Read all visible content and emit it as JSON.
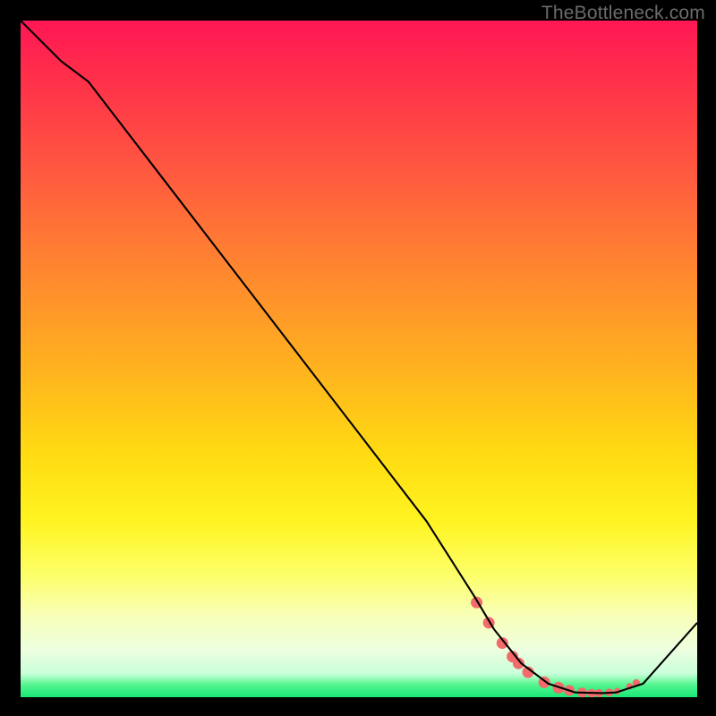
{
  "attribution": "TheBottleneck.com",
  "chart_data": {
    "type": "line",
    "title": "",
    "xlabel": "",
    "ylabel": "",
    "xlim": [
      0,
      100
    ],
    "ylim": [
      0,
      100
    ],
    "series": [
      {
        "name": "curve",
        "x": [
          0,
          6,
          10,
          20,
          30,
          40,
          50,
          60,
          67,
          70,
          74,
          78,
          82,
          86,
          88,
          92,
          100
        ],
        "y": [
          100,
          94,
          91,
          78,
          65,
          52,
          39,
          26,
          15,
          10,
          5,
          2,
          0.7,
          0.6,
          0.7,
          2,
          11
        ]
      }
    ],
    "markers": {
      "name": "cluster",
      "color": "#f26a6a",
      "x": [
        67.4,
        69.2,
        71.2,
        72.7,
        73.6,
        75.0,
        77.4,
        79.5,
        81.1,
        83.0,
        84.4,
        85.5,
        87.0,
        88.2,
        90.0,
        91.0
      ],
      "y": [
        14.0,
        11.0,
        8.0,
        6.0,
        5.0,
        3.7,
        2.2,
        1.4,
        1.0,
        0.7,
        0.6,
        0.6,
        0.7,
        0.9,
        1.6,
        2.1
      ],
      "r": [
        6.5,
        6.5,
        6.5,
        6.5,
        6.5,
        6.5,
        6.5,
        6.5,
        6.0,
        5.5,
        4.8,
        4.6,
        4.5,
        3.8,
        3.6,
        4.2
      ]
    },
    "gradient_stops": [
      {
        "pct": 0,
        "color": "#ff1756"
      },
      {
        "pct": 22,
        "color": "#ff5840"
      },
      {
        "pct": 52,
        "color": "#ffb41e"
      },
      {
        "pct": 74,
        "color": "#fff421"
      },
      {
        "pct": 93,
        "color": "#edffdf"
      },
      {
        "pct": 100,
        "color": "#18e876"
      }
    ]
  }
}
